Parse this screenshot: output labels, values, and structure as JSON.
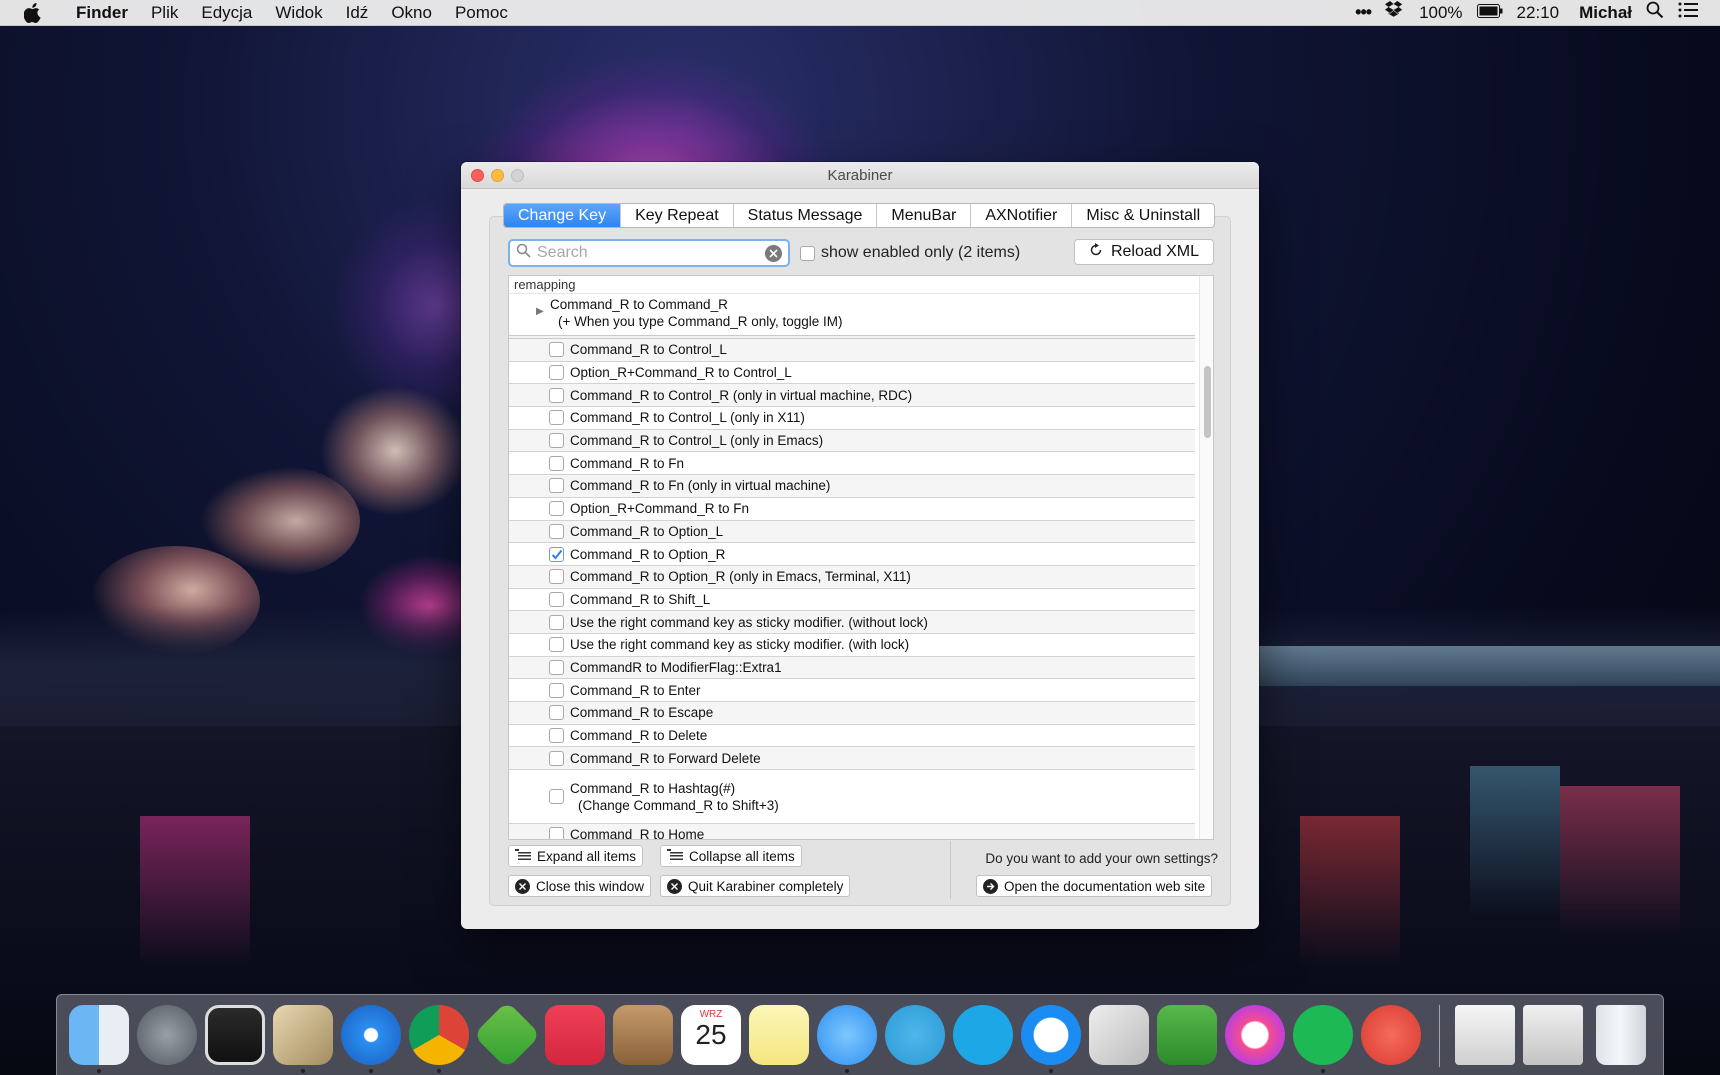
{
  "menubar": {
    "app": "Finder",
    "menus": [
      "Plik",
      "Edycja",
      "Widok",
      "Idź",
      "Okno",
      "Pomoc"
    ],
    "battery": "100%",
    "time": "22:10",
    "user": "Michał"
  },
  "window": {
    "title": "Karabiner",
    "tabs": [
      "Change Key",
      "Key Repeat",
      "Status Message",
      "MenuBar",
      "AXNotifier",
      "Misc & Uninstall"
    ],
    "active_tab": "Change Key",
    "search_placeholder": "Search",
    "show_enabled_label": "show enabled only (2 items)",
    "reload_label": "Reload XML",
    "list_header": "remapping",
    "group": {
      "title": "Command_R to Command_R",
      "subtitle": "(+ When you type Command_R only, toggle IM)"
    },
    "items": [
      {
        "label": "Command_R to Control_L",
        "checked": false
      },
      {
        "label": "Option_R+Command_R to Control_L",
        "checked": false
      },
      {
        "label": "Command_R to Control_R (only in virtual machine, RDC)",
        "checked": false
      },
      {
        "label": "Command_R to Control_L (only in X11)",
        "checked": false
      },
      {
        "label": "Command_R to Control_L (only in Emacs)",
        "checked": false
      },
      {
        "label": "Command_R to Fn",
        "checked": false
      },
      {
        "label": "Command_R to Fn (only in virtual machine)",
        "checked": false
      },
      {
        "label": "Option_R+Command_R to Fn",
        "checked": false
      },
      {
        "label": "Command_R to Option_L",
        "checked": false
      },
      {
        "label": "Command_R to Option_R",
        "checked": true
      },
      {
        "label": "Command_R to Option_R (only in Emacs, Terminal, X11)",
        "checked": false
      },
      {
        "label": "Command_R to Shift_L",
        "checked": false
      },
      {
        "label": "Use the right command key as sticky modifier. (without lock)",
        "checked": false
      },
      {
        "label": "Use the right command key as sticky modifier. (with lock)",
        "checked": false
      },
      {
        "label": "CommandR to ModifierFlag::Extra1",
        "checked": false
      },
      {
        "label": "Command_R to Enter",
        "checked": false
      },
      {
        "label": "Command_R to Escape",
        "checked": false
      },
      {
        "label": "Command_R to Delete",
        "checked": false
      },
      {
        "label": "Command_R to Forward Delete",
        "checked": false
      }
    ],
    "tall_item": {
      "label": "Command_R to Hashtag(#)",
      "sub": "(Change Command_R to Shift+3)"
    },
    "partial_item": "Command_R to Home",
    "footer": {
      "expand": "Expand all items",
      "collapse": "Collapse all items",
      "close": "Close this window",
      "quit": "Quit Karabiner completely",
      "ask": "Do you want to add your own settings?",
      "docs": "Open the documentation web site"
    }
  },
  "dock": {
    "calendar_month": "WRZ",
    "calendar_day": "25",
    "icons": [
      "finder-icon",
      "launchpad-icon",
      "activity-icon",
      "preview-icon",
      "safari-icon",
      "chrome-icon",
      "feedly-icon",
      "pocket-icon",
      "contacts-icon",
      "calendar-icon",
      "notes-icon",
      "messages-icon",
      "telegram-icon",
      "skype-icon",
      "messenger-icon",
      "preview-photos-icon",
      "evernote-icon",
      "itunes-icon",
      "spotify-icon",
      "downloader-icon",
      "image-stack-icon",
      "documents-stack-icon",
      "trash-icon"
    ]
  }
}
